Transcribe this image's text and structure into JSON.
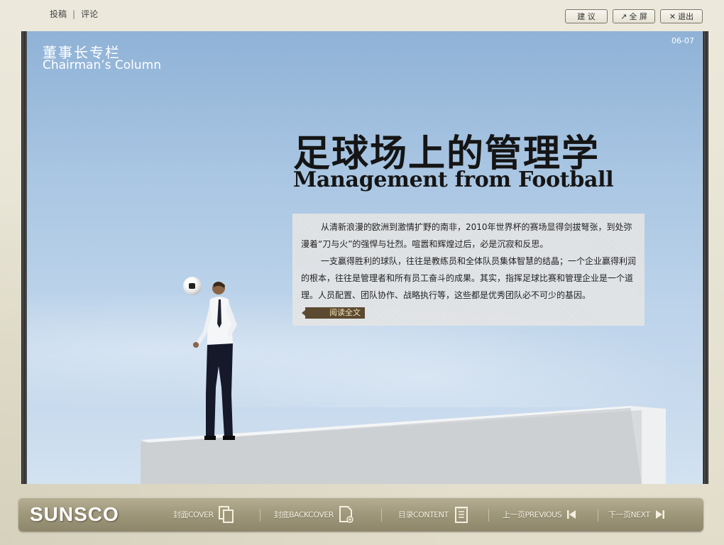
{
  "top_links": {
    "submit": "投稿",
    "separator": "|",
    "comment": "评论"
  },
  "top_buttons": {
    "suggest": "建 议",
    "fullscreen": "全 屏",
    "exit": "退出"
  },
  "page": {
    "page_number": "06-07",
    "column_cn": "董事长专栏",
    "column_en": "Chairman’s Column",
    "title_cn": "足球场上的管理学",
    "title_en": "Management from Football",
    "para1": "从清新浪漫的欧洲到激情扩野的南非，2010年世界杯的赛场显得剑拔弩张，到处弥漫着“刀与火”的强悍与壮烈。喧嚣和辉煌过后，必是沉寂和反思。",
    "para2": "一支赢得胜利的球队，往往是教练员和全体队员集体智慧的结晶；一个企业赢得利润的根本，往往是管理者和所有员工奋斗的成果。其实，指挥足球比赛和管理企业是一个道理。人员配置、团队协作、战略执行等，这些都是优秀团队必不可少的基因。",
    "read_more": "阅读全文"
  },
  "bottom_bar": {
    "logo": "SUNSCO",
    "cover": "封面COVER",
    "back_cover": "封底BACKCOVER",
    "contents": "目录CONTENT",
    "previous": "上一页PREVIOUS",
    "next": "下一页NEXT"
  }
}
